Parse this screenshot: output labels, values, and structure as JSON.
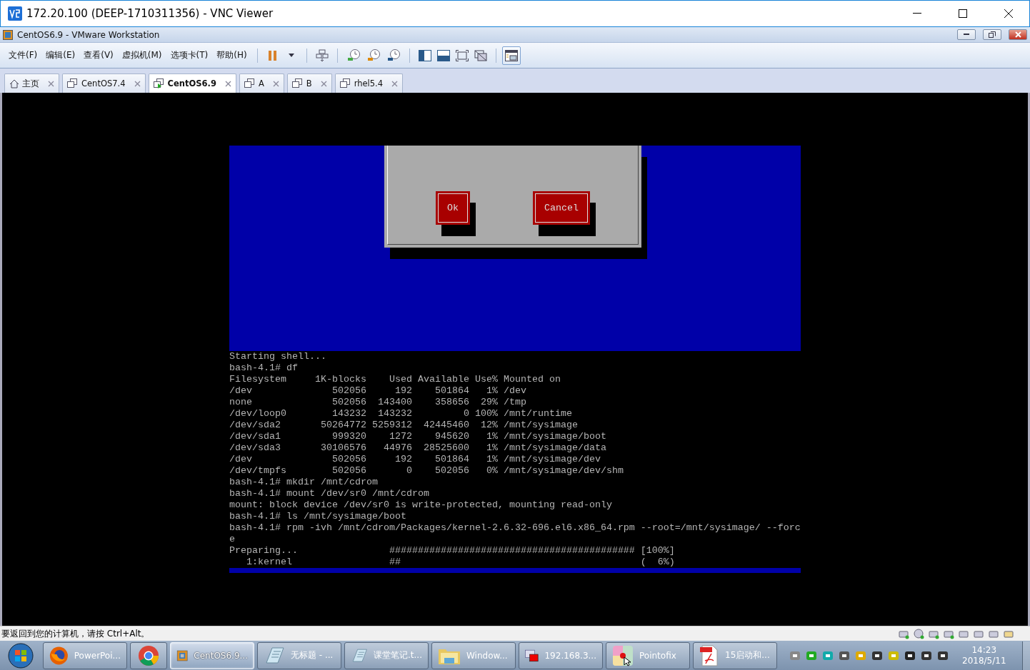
{
  "vnc_window": {
    "title": "172.20.100 (DEEP-1710311356) - VNC Viewer"
  },
  "vmware_window": {
    "title": "CentOS6.9 - VMware Workstation"
  },
  "menu": [
    "文件(F)",
    "编辑(E)",
    "查看(V)",
    "虚拟机(M)",
    "选项卡(T)",
    "帮助(H)"
  ],
  "toolbar_buttons": [
    {
      "kind": "pause",
      "pressed": false
    },
    {
      "kind": "dropdown",
      "pressed": false
    },
    {
      "kind": "send-keys",
      "pressed": false
    },
    {
      "kind": "snapshot",
      "pressed": false
    },
    {
      "kind": "revert",
      "pressed": false
    },
    {
      "kind": "manager",
      "pressed": false
    },
    {
      "kind": "sidebar",
      "pressed": false
    },
    {
      "kind": "console",
      "pressed": false
    },
    {
      "kind": "fullscreen",
      "pressed": false
    },
    {
      "kind": "unity",
      "pressed": false
    },
    {
      "kind": "library",
      "pressed": true
    }
  ],
  "tabs": [
    {
      "label": "主页",
      "kind": "home",
      "selected": false
    },
    {
      "label": "CentOS7.4",
      "kind": "vm",
      "selected": false
    },
    {
      "label": "CentOS6.9",
      "kind": "vm",
      "selected": true
    },
    {
      "label": "A",
      "kind": "vm",
      "selected": false
    },
    {
      "label": "B",
      "kind": "vm",
      "selected": false
    },
    {
      "label": "rhel5.4",
      "kind": "vm",
      "selected": false
    }
  ],
  "dialog": {
    "buttons": [
      "Ok",
      "Cancel"
    ]
  },
  "terminal": {
    "lines": [
      "Starting shell...",
      "bash-4.1# df",
      "Filesystem     1K-blocks    Used Available Use% Mounted on",
      "/dev              502056     192    501864   1% /dev",
      "none              502056  143400    358656  29% /tmp",
      "/dev/loop0        143232  143232         0 100% /mnt/runtime",
      "/dev/sda2       50264772 5259312  42445460  12% /mnt/sysimage",
      "/dev/sda1         999320    1272    945620   1% /mnt/sysimage/boot",
      "/dev/sda3       30106576   44976  28525600   1% /mnt/sysimage/data",
      "/dev              502056     192    501864   1% /mnt/sysimage/dev",
      "/dev/tmpfs        502056       0    502056   0% /mnt/sysimage/dev/shm",
      "bash-4.1# mkdir /mnt/cdrom",
      "bash-4.1# mount /dev/sr0 /mnt/cdrom",
      "mount: block device /dev/sr0 is write-protected, mounting read-only",
      "bash-4.1# ls /mnt/sysimage/boot",
      "bash-4.1# rpm -ivh /mnt/cdrom/Packages/kernel-2.6.32-696.el6.x86_64.rpm --root=/mnt/sysimage/ --forc",
      "e",
      "Preparing...                ########################################### [100%]",
      "   1:kernel                 ##                                          (  6%)"
    ]
  },
  "status_bar": {
    "text": "要返回到您的计算机，请按 Ctrl+Alt。"
  },
  "taskbar": {
    "items": [
      {
        "label": "PowerPoi...",
        "kind": "firefox",
        "selected": false
      },
      {
        "kind": "chrome",
        "selected": false
      },
      {
        "label": "CentOS6.9...",
        "kind": "vmware",
        "selected": true
      },
      {
        "label": "无标题 - ...",
        "kind": "notepad",
        "selected": false
      },
      {
        "label": "课堂笔记.t...",
        "kind": "notepad",
        "selected": false
      },
      {
        "label": "Window...",
        "kind": "explorer",
        "selected": false
      },
      {
        "label": "192.168.3...",
        "kind": "vnc",
        "selected": false
      },
      {
        "label": "Pointofix",
        "kind": "pointofix",
        "selected": false
      },
      {
        "label": "15启动和...",
        "kind": "pdf",
        "selected": false
      }
    ],
    "time": "14:23",
    "date": "2018/5/11"
  }
}
